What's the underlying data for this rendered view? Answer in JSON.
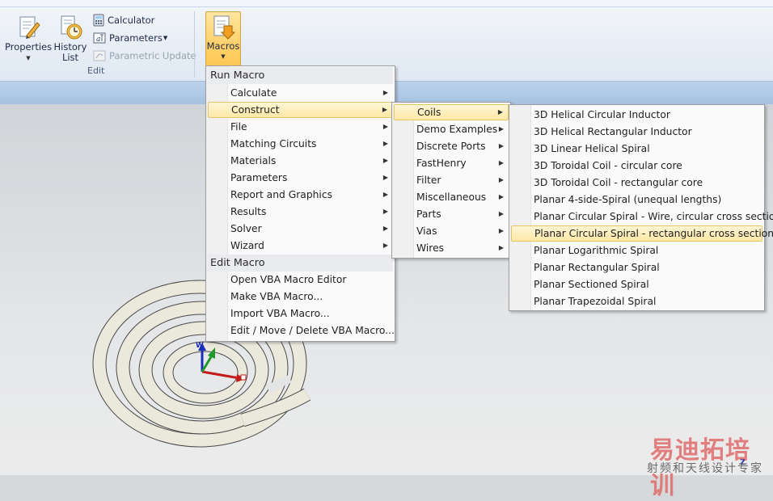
{
  "ribbon": {
    "properties_label": "Properties",
    "history_label": "History",
    "history_label2": "List",
    "calculator_label": "Calculator",
    "parameters_label": "Parameters",
    "parametric_update_label": "Parametric Update",
    "group_label": "Edit",
    "macros_label": "Macros"
  },
  "menu1": {
    "header1": "Run Macro",
    "items": [
      {
        "label": "Calculate",
        "submenu": true
      },
      {
        "label": "Construct",
        "submenu": true
      },
      {
        "label": "File",
        "submenu": true
      },
      {
        "label": "Matching Circuits",
        "submenu": true
      },
      {
        "label": "Materials",
        "submenu": true
      },
      {
        "label": "Parameters",
        "submenu": true
      },
      {
        "label": "Report and Graphics",
        "submenu": true
      },
      {
        "label": "Results",
        "submenu": true
      },
      {
        "label": "Solver",
        "submenu": true
      },
      {
        "label": "Wizard",
        "submenu": true
      }
    ],
    "header2": "Edit Macro",
    "edit_items": [
      {
        "label": "Open VBA Macro Editor"
      },
      {
        "label": "Make VBA Macro..."
      },
      {
        "label": "Import VBA Macro..."
      },
      {
        "label": "Edit / Move / Delete VBA Macro..."
      }
    ]
  },
  "menu2": {
    "items": [
      {
        "label": "Coils"
      },
      {
        "label": "Demo Examples"
      },
      {
        "label": "Discrete Ports"
      },
      {
        "label": "FastHenry"
      },
      {
        "label": "Filter"
      },
      {
        "label": "Miscellaneous"
      },
      {
        "label": "Parts"
      },
      {
        "label": "Vias"
      },
      {
        "label": "Wires"
      }
    ]
  },
  "menu3": {
    "items": [
      {
        "label": "3D Helical Circular Inductor"
      },
      {
        "label": "3D Helical Rectangular Inductor"
      },
      {
        "label": "3D Linear Helical Spiral"
      },
      {
        "label": "3D Toroidal Coil - circular core"
      },
      {
        "label": "3D Toroidal Coil - rectangular core"
      },
      {
        "label": "Planar 4-side-Spiral (unequal lengths)"
      },
      {
        "label": "Planar Circular Spiral - Wire, circular cross section"
      },
      {
        "label": "Planar Circular Spiral - rectangular cross section"
      },
      {
        "label": "Planar Logarithmic Spiral"
      },
      {
        "label": "Planar Rectangular Spiral"
      },
      {
        "label": "Planar Sectioned Spiral"
      },
      {
        "label": "Planar Trapezoidal Spiral"
      }
    ]
  },
  "axes": {
    "w": "W",
    "z": "Z"
  },
  "watermark": {
    "line1": "易迪拓培训",
    "line2": "射频和天线设计专家"
  },
  "colors": {
    "highlight": "#fde8a6",
    "ribbon_accent": "#ffc24a",
    "watermark_red": "#e06b6b"
  }
}
